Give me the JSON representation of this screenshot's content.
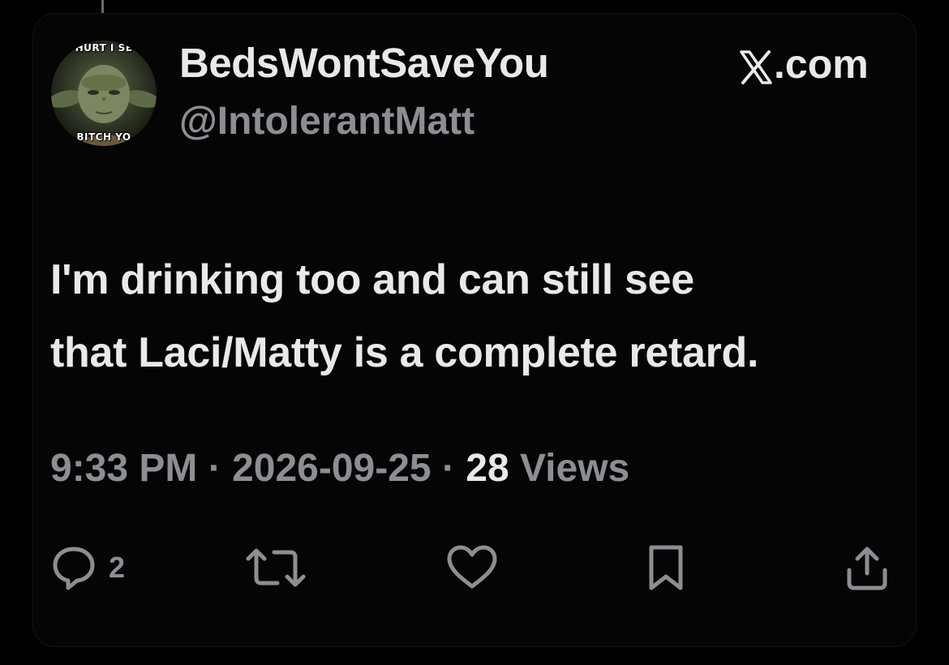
{
  "author": {
    "display_name": "BedsWontSaveYou",
    "handle": "@IntolerantMatt",
    "avatar": {
      "icon": "yoda-meme-avatar",
      "caption_top": "HURT I SE",
      "caption_bottom": "BITCH YO"
    }
  },
  "brand": {
    "icon": "x-logo-icon",
    "label": ".com"
  },
  "tweet": {
    "line1": "I'm drinking too and can still see",
    "line2": "that Laci/Matty is a complete retard."
  },
  "meta": {
    "time": "9:33 PM",
    "separator": "·",
    "date": "2026-09-25",
    "views_count": "28",
    "views_label": "Views"
  },
  "actions": {
    "reply": {
      "icon": "reply-icon",
      "count": "2"
    },
    "repost": {
      "icon": "repost-icon"
    },
    "like": {
      "icon": "heart-icon"
    },
    "bookmark": {
      "icon": "bookmark-icon"
    },
    "share": {
      "icon": "share-icon"
    }
  },
  "colors": {
    "background": "#000000",
    "primary_text": "#e7e9ea",
    "secondary_text": "#8b8f94"
  }
}
